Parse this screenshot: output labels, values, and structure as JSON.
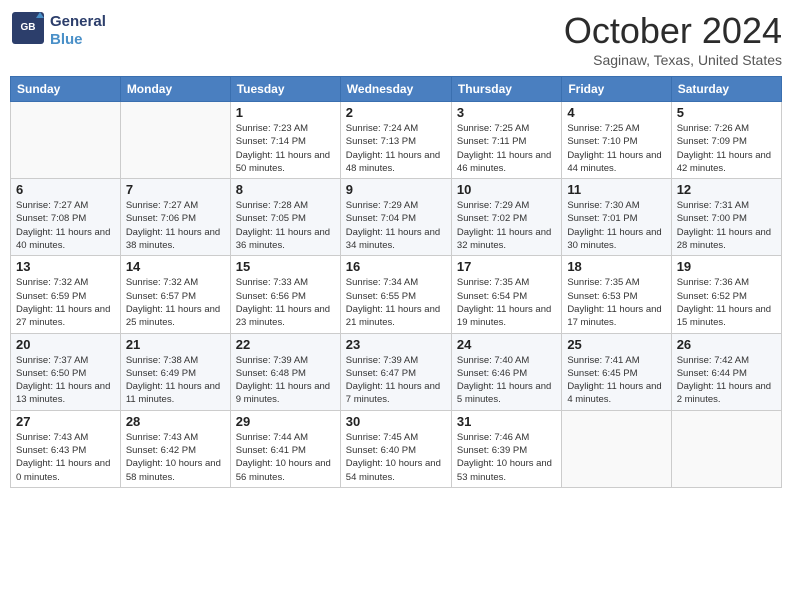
{
  "header": {
    "logo_line1": "General",
    "logo_line2": "Blue",
    "month_title": "October 2024",
    "location": "Saginaw, Texas, United States"
  },
  "days_of_week": [
    "Sunday",
    "Monday",
    "Tuesday",
    "Wednesday",
    "Thursday",
    "Friday",
    "Saturday"
  ],
  "weeks": [
    [
      {
        "day": "",
        "info": ""
      },
      {
        "day": "",
        "info": ""
      },
      {
        "day": "1",
        "info": "Sunrise: 7:23 AM\nSunset: 7:14 PM\nDaylight: 11 hours and 50 minutes."
      },
      {
        "day": "2",
        "info": "Sunrise: 7:24 AM\nSunset: 7:13 PM\nDaylight: 11 hours and 48 minutes."
      },
      {
        "day": "3",
        "info": "Sunrise: 7:25 AM\nSunset: 7:11 PM\nDaylight: 11 hours and 46 minutes."
      },
      {
        "day": "4",
        "info": "Sunrise: 7:25 AM\nSunset: 7:10 PM\nDaylight: 11 hours and 44 minutes."
      },
      {
        "day": "5",
        "info": "Sunrise: 7:26 AM\nSunset: 7:09 PM\nDaylight: 11 hours and 42 minutes."
      }
    ],
    [
      {
        "day": "6",
        "info": "Sunrise: 7:27 AM\nSunset: 7:08 PM\nDaylight: 11 hours and 40 minutes."
      },
      {
        "day": "7",
        "info": "Sunrise: 7:27 AM\nSunset: 7:06 PM\nDaylight: 11 hours and 38 minutes."
      },
      {
        "day": "8",
        "info": "Sunrise: 7:28 AM\nSunset: 7:05 PM\nDaylight: 11 hours and 36 minutes."
      },
      {
        "day": "9",
        "info": "Sunrise: 7:29 AM\nSunset: 7:04 PM\nDaylight: 11 hours and 34 minutes."
      },
      {
        "day": "10",
        "info": "Sunrise: 7:29 AM\nSunset: 7:02 PM\nDaylight: 11 hours and 32 minutes."
      },
      {
        "day": "11",
        "info": "Sunrise: 7:30 AM\nSunset: 7:01 PM\nDaylight: 11 hours and 30 minutes."
      },
      {
        "day": "12",
        "info": "Sunrise: 7:31 AM\nSunset: 7:00 PM\nDaylight: 11 hours and 28 minutes."
      }
    ],
    [
      {
        "day": "13",
        "info": "Sunrise: 7:32 AM\nSunset: 6:59 PM\nDaylight: 11 hours and 27 minutes."
      },
      {
        "day": "14",
        "info": "Sunrise: 7:32 AM\nSunset: 6:57 PM\nDaylight: 11 hours and 25 minutes."
      },
      {
        "day": "15",
        "info": "Sunrise: 7:33 AM\nSunset: 6:56 PM\nDaylight: 11 hours and 23 minutes."
      },
      {
        "day": "16",
        "info": "Sunrise: 7:34 AM\nSunset: 6:55 PM\nDaylight: 11 hours and 21 minutes."
      },
      {
        "day": "17",
        "info": "Sunrise: 7:35 AM\nSunset: 6:54 PM\nDaylight: 11 hours and 19 minutes."
      },
      {
        "day": "18",
        "info": "Sunrise: 7:35 AM\nSunset: 6:53 PM\nDaylight: 11 hours and 17 minutes."
      },
      {
        "day": "19",
        "info": "Sunrise: 7:36 AM\nSunset: 6:52 PM\nDaylight: 11 hours and 15 minutes."
      }
    ],
    [
      {
        "day": "20",
        "info": "Sunrise: 7:37 AM\nSunset: 6:50 PM\nDaylight: 11 hours and 13 minutes."
      },
      {
        "day": "21",
        "info": "Sunrise: 7:38 AM\nSunset: 6:49 PM\nDaylight: 11 hours and 11 minutes."
      },
      {
        "day": "22",
        "info": "Sunrise: 7:39 AM\nSunset: 6:48 PM\nDaylight: 11 hours and 9 minutes."
      },
      {
        "day": "23",
        "info": "Sunrise: 7:39 AM\nSunset: 6:47 PM\nDaylight: 11 hours and 7 minutes."
      },
      {
        "day": "24",
        "info": "Sunrise: 7:40 AM\nSunset: 6:46 PM\nDaylight: 11 hours and 5 minutes."
      },
      {
        "day": "25",
        "info": "Sunrise: 7:41 AM\nSunset: 6:45 PM\nDaylight: 11 hours and 4 minutes."
      },
      {
        "day": "26",
        "info": "Sunrise: 7:42 AM\nSunset: 6:44 PM\nDaylight: 11 hours and 2 minutes."
      }
    ],
    [
      {
        "day": "27",
        "info": "Sunrise: 7:43 AM\nSunset: 6:43 PM\nDaylight: 11 hours and 0 minutes."
      },
      {
        "day": "28",
        "info": "Sunrise: 7:43 AM\nSunset: 6:42 PM\nDaylight: 10 hours and 58 minutes."
      },
      {
        "day": "29",
        "info": "Sunrise: 7:44 AM\nSunset: 6:41 PM\nDaylight: 10 hours and 56 minutes."
      },
      {
        "day": "30",
        "info": "Sunrise: 7:45 AM\nSunset: 6:40 PM\nDaylight: 10 hours and 54 minutes."
      },
      {
        "day": "31",
        "info": "Sunrise: 7:46 AM\nSunset: 6:39 PM\nDaylight: 10 hours and 53 minutes."
      },
      {
        "day": "",
        "info": ""
      },
      {
        "day": "",
        "info": ""
      }
    ]
  ]
}
